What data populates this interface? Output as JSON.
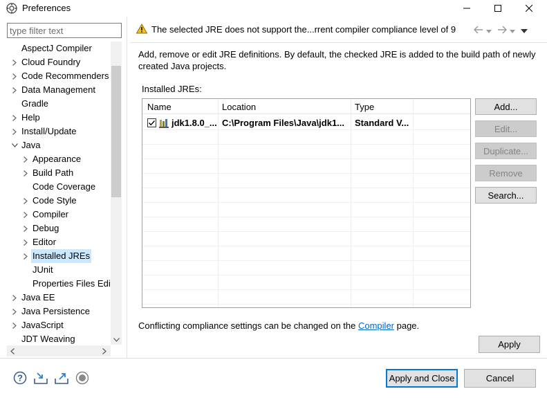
{
  "window": {
    "title": "Preferences",
    "app_icon": "eclipse-preferences-icon"
  },
  "filter": {
    "placeholder": "type filter text",
    "value": ""
  },
  "tree": {
    "items": [
      {
        "label": "AspectJ Compiler",
        "level": 0,
        "expandable": false
      },
      {
        "label": "Cloud Foundry",
        "level": 0,
        "expandable": true
      },
      {
        "label": "Code Recommenders",
        "level": 0,
        "expandable": true
      },
      {
        "label": "Data Management",
        "level": 0,
        "expandable": true
      },
      {
        "label": "Gradle",
        "level": 0,
        "expandable": false
      },
      {
        "label": "Help",
        "level": 0,
        "expandable": true
      },
      {
        "label": "Install/Update",
        "level": 0,
        "expandable": true
      },
      {
        "label": "Java",
        "level": 0,
        "expandable": true,
        "expanded": true
      },
      {
        "label": "Appearance",
        "level": 1,
        "expandable": true
      },
      {
        "label": "Build Path",
        "level": 1,
        "expandable": true
      },
      {
        "label": "Code Coverage",
        "level": 1,
        "expandable": false
      },
      {
        "label": "Code Style",
        "level": 1,
        "expandable": true
      },
      {
        "label": "Compiler",
        "level": 1,
        "expandable": true
      },
      {
        "label": "Debug",
        "level": 1,
        "expandable": true
      },
      {
        "label": "Editor",
        "level": 1,
        "expandable": true
      },
      {
        "label": "Installed JREs",
        "level": 1,
        "expandable": true,
        "selected": true
      },
      {
        "label": "JUnit",
        "level": 1,
        "expandable": false
      },
      {
        "label": "Properties Files Edit",
        "level": 1,
        "expandable": false
      },
      {
        "label": "Java EE",
        "level": 0,
        "expandable": true
      },
      {
        "label": "Java Persistence",
        "level": 0,
        "expandable": true
      },
      {
        "label": "JavaScript",
        "level": 0,
        "expandable": true
      },
      {
        "label": "JDT Weaving",
        "level": 0,
        "expandable": false
      }
    ]
  },
  "header": {
    "warning_icon": "warning-icon",
    "warning_text": "The selected JRE does not support the...rrent compiler compliance level of 9"
  },
  "page": {
    "description": "Add, remove or edit JRE definitions. By default, the checked JRE is added to the build path of newly created Java projects.",
    "installed_label": "Installed JREs:",
    "table": {
      "columns": [
        "Name",
        "Location",
        "Type"
      ],
      "rows": [
        {
          "checked": true,
          "name": "jdk1.8.0_...",
          "location": "C:\\Program Files\\Java\\jdk1...",
          "type": "Standard V..."
        }
      ]
    },
    "buttons": {
      "add": "Add...",
      "edit": "Edit...",
      "duplicate": "Duplicate...",
      "remove": "Remove",
      "search": "Search..."
    },
    "conflict_prefix": "Conflicting compliance settings can be changed on the ",
    "conflict_link": "Compiler",
    "conflict_suffix": " page.",
    "apply": "Apply"
  },
  "footer": {
    "apply_and_close": "Apply and Close",
    "cancel": "Cancel",
    "icons": [
      "help-icon",
      "import-icon",
      "export-icon",
      "record-icon"
    ]
  },
  "colors": {
    "selection": "#cce8ff",
    "link": "#0066cc",
    "default_button_border": "#0078d7",
    "warning": "#f2c12e"
  }
}
